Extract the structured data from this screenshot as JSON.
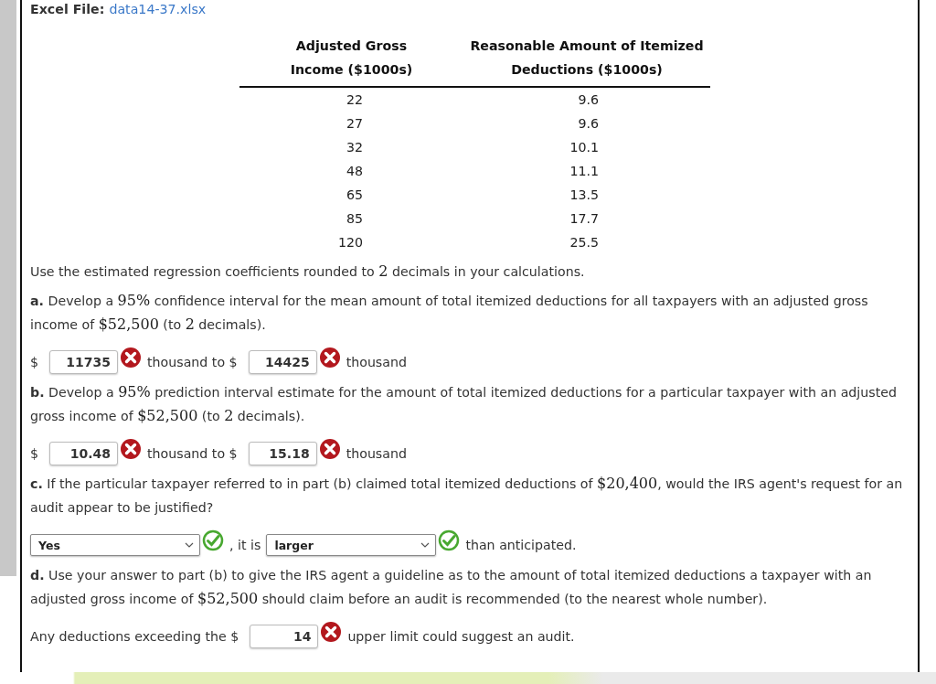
{
  "excel_file": {
    "label": "Excel File:",
    "link": "data14-37.xlsx"
  },
  "table": {
    "columns": [
      {
        "lines": [
          "Adjusted Gross",
          "Income ($1000s)"
        ]
      },
      {
        "lines": [
          "Reasonable Amount of Itemized",
          "Deductions ($1000s)"
        ]
      }
    ],
    "rows": [
      [
        "22",
        "9.6"
      ],
      [
        "27",
        "9.6"
      ],
      [
        "32",
        "10.1"
      ],
      [
        "48",
        "11.1"
      ],
      [
        "65",
        "13.5"
      ],
      [
        "85",
        "17.7"
      ],
      [
        "120",
        "25.5"
      ]
    ]
  },
  "intro": [
    {
      "kind": "text",
      "text": "Use the estimated regression coefficients rounded to "
    },
    {
      "kind": "math",
      "text": "2"
    },
    {
      "kind": "text",
      "text": " decimals in your calculations."
    }
  ],
  "questions": [
    {
      "label": "a.",
      "parts": [
        {
          "kind": "text",
          "text": " Develop a "
        },
        {
          "kind": "math",
          "text": "95%"
        },
        {
          "kind": "text",
          "text": " confidence interval for the mean amount of total itemized deductions for all taxpayers with an adjusted gross income of "
        },
        {
          "kind": "math",
          "text": "$52,500"
        },
        {
          "kind": "text",
          "text": " (to "
        },
        {
          "kind": "math",
          "text": "2"
        },
        {
          "kind": "text",
          "text": " decimals)."
        }
      ],
      "answer": [
        {
          "kind": "text",
          "text": "$"
        },
        {
          "kind": "input",
          "value": "11735"
        },
        {
          "kind": "mark",
          "correct": false
        },
        {
          "kind": "text",
          "text": "thousand to $"
        },
        {
          "kind": "input",
          "value": "14425"
        },
        {
          "kind": "mark",
          "correct": false
        },
        {
          "kind": "text",
          "text": "thousand"
        }
      ]
    },
    {
      "label": "b.",
      "parts": [
        {
          "kind": "text",
          "text": " Develop a "
        },
        {
          "kind": "math",
          "text": "95%"
        },
        {
          "kind": "text",
          "text": " prediction interval estimate for the amount of total itemized deductions for a particular taxpayer with an adjusted gross income of "
        },
        {
          "kind": "math",
          "text": "$52,500"
        },
        {
          "kind": "text",
          "text": " (to "
        },
        {
          "kind": "math",
          "text": "2"
        },
        {
          "kind": "text",
          "text": " decimals)."
        }
      ],
      "answer": [
        {
          "kind": "text",
          "text": "$"
        },
        {
          "kind": "input",
          "value": "10.48"
        },
        {
          "kind": "mark",
          "correct": false
        },
        {
          "kind": "text",
          "text": "thousand to $"
        },
        {
          "kind": "input",
          "value": "15.18"
        },
        {
          "kind": "mark",
          "correct": false
        },
        {
          "kind": "text",
          "text": "thousand"
        }
      ]
    },
    {
      "label": "c.",
      "parts": [
        {
          "kind": "text",
          "text": " If the particular taxpayer referred to in part (b) claimed total itemized deductions of "
        },
        {
          "kind": "math",
          "text": "$20,400"
        },
        {
          "kind": "text",
          "text": ", would the IRS agent's request for an audit appear to be justified?"
        }
      ],
      "answer": [
        {
          "kind": "select",
          "value": "Yes"
        },
        {
          "kind": "mark",
          "correct": true
        },
        {
          "kind": "text",
          "text": ", it is"
        },
        {
          "kind": "select",
          "value": "larger"
        },
        {
          "kind": "mark",
          "correct": true
        },
        {
          "kind": "text",
          "text": "than anticipated."
        }
      ]
    },
    {
      "label": "d.",
      "parts": [
        {
          "kind": "text",
          "text": " Use your answer to part (b) to give the IRS agent a guideline as to the amount of total itemized deductions a taxpayer with an adjusted gross income of "
        },
        {
          "kind": "math",
          "text": "$52,500"
        },
        {
          "kind": "text",
          "text": " should claim before an audit is recommended (to the nearest whole number)."
        }
      ],
      "answer": [
        {
          "kind": "text",
          "text": "Any deductions exceeding the $"
        },
        {
          "kind": "input",
          "value": "14"
        },
        {
          "kind": "mark",
          "correct": false
        },
        {
          "kind": "text",
          "text": "upper limit could suggest an audit."
        }
      ]
    }
  ]
}
